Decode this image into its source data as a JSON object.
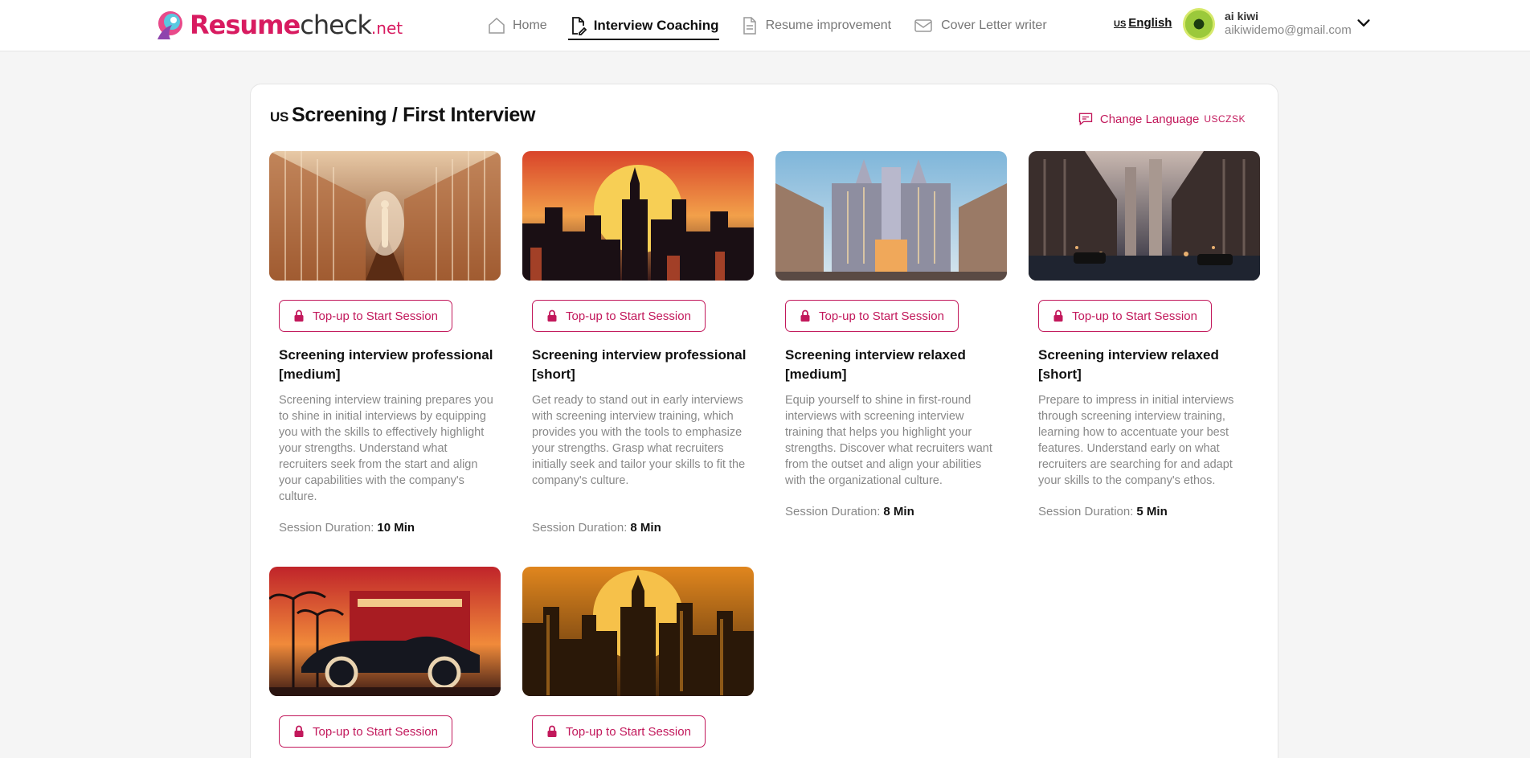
{
  "brand": {
    "part1": "Resume",
    "part2": "check",
    "part3": ".net"
  },
  "nav": {
    "items": [
      {
        "label": "Home",
        "icon": "home-icon"
      },
      {
        "label": "Interview Coaching",
        "icon": "edit-document-icon",
        "active": true
      },
      {
        "label": "Resume improvement",
        "icon": "document-icon"
      },
      {
        "label": "Cover Letter writer",
        "icon": "mail-icon"
      }
    ]
  },
  "language": {
    "flag": "US",
    "label": "English"
  },
  "user": {
    "name": "ai kiwi",
    "email": "aikiwidemo@gmail.com"
  },
  "page": {
    "flag": "US",
    "title": "Screening / First Interview",
    "change_language_label": "Change Language",
    "change_language_codes": "USCZSK"
  },
  "cards": [
    {
      "button_label": "Top-up to Start Session",
      "title": "Screening interview professional [medium]",
      "description": "Screening interview training prepares you to shine in initial interviews by equipping you with the skills to effectively highlight your strengths. Understand what recruiters seek from the start and align your capabilities with the company's culture.",
      "duration_label": "Session Duration:",
      "duration": "10 Min"
    },
    {
      "button_label": "Top-up to Start Session",
      "title": "Screening interview professional [short]",
      "description": "Get ready to stand out in early interviews with screening interview training, which provides you with the tools to emphasize your strengths. Grasp what recruiters initially seek and tailor your skills to fit the company's culture.",
      "duration_label": "Session Duration:",
      "duration": "8 Min"
    },
    {
      "button_label": "Top-up to Start Session",
      "title": "Screening interview relaxed [medium]",
      "description": "Equip yourself to shine in first-round interviews with screening interview training that helps you highlight your strengths. Discover what recruiters want from the outset and align your abilities with the organizational culture.",
      "duration_label": "Session Duration:",
      "duration": "8 Min"
    },
    {
      "button_label": "Top-up to Start Session",
      "title": "Screening interview relaxed [short]",
      "description": "Prepare to impress in initial interviews through screening interview training, learning how to accentuate your best features. Understand early on what recruiters are searching for and adapt your skills to the company's ethos.",
      "duration_label": "Session Duration:",
      "duration": "5 Min"
    },
    {
      "button_label": "Top-up to Start Session"
    },
    {
      "button_label": "Top-up to Start Session"
    }
  ],
  "colors": {
    "accent": "#c2185b",
    "brand_pink": "#d81b60"
  }
}
